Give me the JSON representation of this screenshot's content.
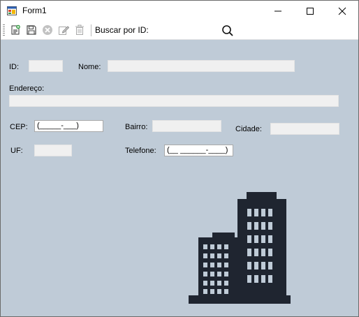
{
  "window": {
    "title": "Form1"
  },
  "toolbar": {
    "buttons": [
      "new-icon",
      "save-icon",
      "delete-icon",
      "edit-icon",
      "trash-icon"
    ],
    "search_label": "Buscar por ID:"
  },
  "form": {
    "id_label": "ID:",
    "nome_label": "Nome:",
    "endereco_label": "Endereço:",
    "cep_label": "CEP:",
    "cep_mask": "(_____-___)",
    "bairro_label": "Bairro:",
    "cidade_label": "Cidade:",
    "uf_label": "UF:",
    "telefone_label": "Telefone:",
    "telefone_mask": "(__ ______-____)"
  },
  "colors": {
    "panel": "#bfcbd7",
    "building": "#1f2530"
  }
}
